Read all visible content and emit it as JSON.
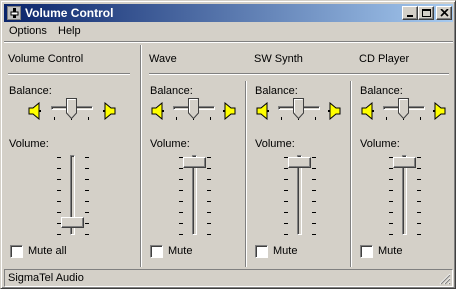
{
  "window": {
    "title": "Volume Control"
  },
  "titlebar_buttons": [
    "minimize-icon",
    "maximize-icon",
    "close-icon"
  ],
  "menu": {
    "items": [
      "Options",
      "Help"
    ]
  },
  "channels": [
    {
      "name": "Volume Control",
      "balance_label": "Balance:",
      "volume_label": "Volume:",
      "mute_label": "Mute all",
      "muted": false,
      "balance": 0.5,
      "volume": 0.0
    },
    {
      "name": "Wave",
      "balance_label": "Balance:",
      "volume_label": "Volume:",
      "mute_label": "Mute",
      "muted": false,
      "balance": 0.5,
      "volume": 1.0
    },
    {
      "name": "SW Synth",
      "balance_label": "Balance:",
      "volume_label": "Volume:",
      "mute_label": "Mute",
      "muted": false,
      "balance": 0.5,
      "volume": 1.0
    },
    {
      "name": "CD Player",
      "balance_label": "Balance:",
      "volume_label": "Volume:",
      "mute_label": "Mute",
      "muted": false,
      "balance": 0.5,
      "volume": 1.0
    }
  ],
  "status": {
    "text": "SigmaTel Audio"
  },
  "icons": {
    "speaker": "speaker-icon",
    "speaker_color": "#ffff00"
  }
}
